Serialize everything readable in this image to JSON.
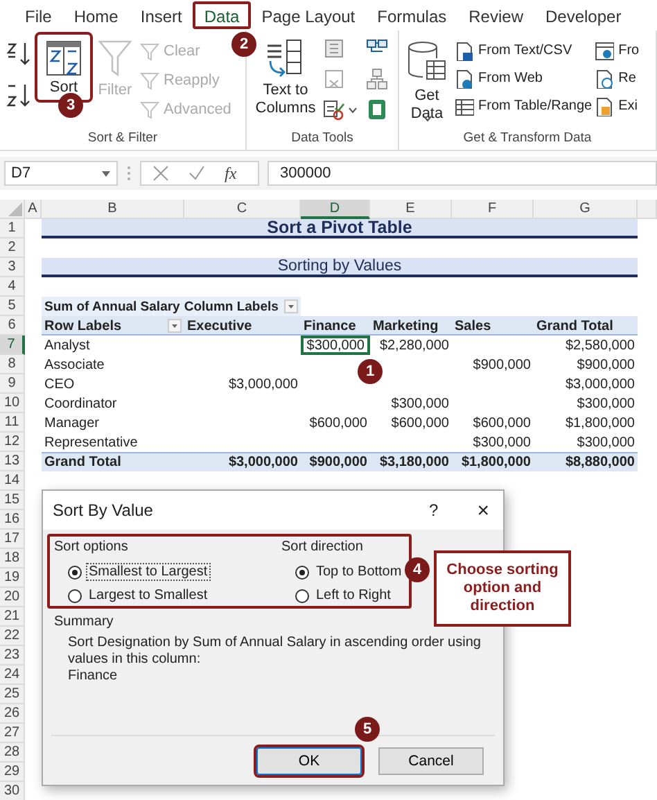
{
  "ribbon": {
    "tabs": [
      {
        "label": "File",
        "selected": false,
        "highlighted": false
      },
      {
        "label": "Home",
        "selected": false,
        "highlighted": false
      },
      {
        "label": "Insert",
        "selected": false,
        "highlighted": false
      },
      {
        "label": "Data",
        "selected": true,
        "highlighted": true
      },
      {
        "label": "Page Layout",
        "selected": false,
        "highlighted": false
      },
      {
        "label": "Formulas",
        "selected": false,
        "highlighted": false
      },
      {
        "label": "Review",
        "selected": false,
        "highlighted": false
      },
      {
        "label": "Developer",
        "selected": false,
        "highlighted": false
      }
    ],
    "sort_filter": {
      "label": "Sort & Filter",
      "sort": {
        "label": "Sort",
        "highlighted": true
      },
      "filter": {
        "label": "Filter",
        "disabled": true
      },
      "small": [
        {
          "label": "Clear",
          "disabled": true
        },
        {
          "label": "Reapply",
          "disabled": true
        },
        {
          "label": "Advanced",
          "disabled": true
        }
      ]
    },
    "data_tools": {
      "label": "Data Tools",
      "text_to_columns": "Text to Columns"
    },
    "get_transform": {
      "label": "Get & Transform Data",
      "get_data": "Get Data",
      "items": [
        "From Text/CSV",
        "From Web",
        "From Table/Range"
      ],
      "items_cut": [
        "Fro",
        "Re",
        "Exi"
      ]
    }
  },
  "formula_bar": {
    "name_box": "D7",
    "fx": "fx",
    "value": "300000"
  },
  "sheet": {
    "columns": [
      {
        "label": "A",
        "selected": false
      },
      {
        "label": "B",
        "selected": false
      },
      {
        "label": "C",
        "selected": false
      },
      {
        "label": "D",
        "selected": true
      },
      {
        "label": "E",
        "selected": false
      },
      {
        "label": "F",
        "selected": false
      },
      {
        "label": "G",
        "selected": false
      }
    ],
    "rows": [
      {
        "label": "1",
        "selected": false
      },
      {
        "label": "2",
        "selected": false
      },
      {
        "label": "3",
        "selected": false
      },
      {
        "label": "4",
        "selected": false
      },
      {
        "label": "5",
        "selected": false
      },
      {
        "label": "6",
        "selected": false
      },
      {
        "label": "7",
        "selected": true
      },
      {
        "label": "8",
        "selected": false
      },
      {
        "label": "9",
        "selected": false
      },
      {
        "label": "10",
        "selected": false
      },
      {
        "label": "11",
        "selected": false
      },
      {
        "label": "12",
        "selected": false
      },
      {
        "label": "13",
        "selected": false
      },
      {
        "label": "14",
        "selected": false
      },
      {
        "label": "15",
        "selected": false
      },
      {
        "label": "16",
        "selected": false
      },
      {
        "label": "17",
        "selected": false
      },
      {
        "label": "18",
        "selected": false
      },
      {
        "label": "19",
        "selected": false
      },
      {
        "label": "20",
        "selected": false
      },
      {
        "label": "21",
        "selected": false
      },
      {
        "label": "22",
        "selected": false
      },
      {
        "label": "23",
        "selected": false
      },
      {
        "label": "24",
        "selected": false
      },
      {
        "label": "25",
        "selected": false
      },
      {
        "label": "26",
        "selected": false
      },
      {
        "label": "27",
        "selected": false
      },
      {
        "label": "28",
        "selected": false
      },
      {
        "label": "29",
        "selected": false
      },
      {
        "label": "30",
        "selected": false
      }
    ],
    "title": "Sort a Pivot Table",
    "subtitle": "Sorting by Values",
    "pivot": {
      "corner": "Sum of Annual Salary",
      "column_labels": "Column Labels",
      "row_labels": "Row Labels",
      "headers": [
        "Executive",
        "Finance",
        "Marketing",
        "Sales",
        "Grand Total"
      ],
      "rows": [
        {
          "label": "Analyst",
          "cells": [
            null,
            {
              "text": "$300,000",
              "selected": true
            },
            {
              "text": "$2,280,000",
              "selected": false
            },
            null,
            {
              "text": "$2,580,000",
              "selected": false
            }
          ]
        },
        {
          "label": "Associate",
          "cells": [
            null,
            null,
            null,
            {
              "text": "$900,000",
              "selected": false
            },
            {
              "text": "$900,000",
              "selected": false
            }
          ]
        },
        {
          "label": "CEO",
          "cells": [
            {
              "text": "$3,000,000",
              "selected": false
            },
            null,
            null,
            null,
            {
              "text": "$3,000,000",
              "selected": false
            }
          ]
        },
        {
          "label": "Coordinator",
          "cells": [
            null,
            null,
            {
              "text": "$300,000",
              "selected": false
            },
            null,
            {
              "text": "$300,000",
              "selected": false
            }
          ]
        },
        {
          "label": "Manager",
          "cells": [
            null,
            {
              "text": "$600,000",
              "selected": false
            },
            {
              "text": "$600,000",
              "selected": false
            },
            {
              "text": "$600,000",
              "selected": false
            },
            {
              "text": "$1,800,000",
              "selected": false
            }
          ]
        },
        {
          "label": "Representative",
          "cells": [
            null,
            null,
            null,
            {
              "text": "$300,000",
              "selected": false
            },
            {
              "text": "$300,000",
              "selected": false
            }
          ]
        }
      ],
      "total": {
        "label": "Grand Total",
        "cells": [
          "$3,000,000",
          "$900,000",
          "$3,180,000",
          "$1,800,000",
          "$8,880,000"
        ]
      }
    }
  },
  "dialog": {
    "title": "Sort By Value",
    "help": "?",
    "close": "×",
    "groups_highlighted": true,
    "groups": [
      {
        "label": "Sort options",
        "choices": [
          {
            "label": "Smallest to Largest",
            "selected": true,
            "focused": true
          },
          {
            "label": "Largest to Smallest",
            "selected": false,
            "focused": false
          }
        ]
      },
      {
        "label": "Sort direction",
        "choices": [
          {
            "label": "Top to Bottom",
            "selected": true,
            "focused": false
          },
          {
            "label": "Left to Right",
            "selected": false,
            "focused": false
          }
        ]
      }
    ],
    "summary_label": "Summary",
    "summary_text": "Sort Designation by Sum of Annual Salary in ascending order using values in this column:",
    "summary_value": "Finance",
    "buttons": [
      {
        "label": "OK",
        "highlighted": true
      },
      {
        "label": "Cancel",
        "highlighted": false
      }
    ]
  },
  "annotations": {
    "badges": [
      "1",
      "2",
      "3",
      "4",
      "5"
    ],
    "callout": "Choose sorting option and direction"
  }
}
